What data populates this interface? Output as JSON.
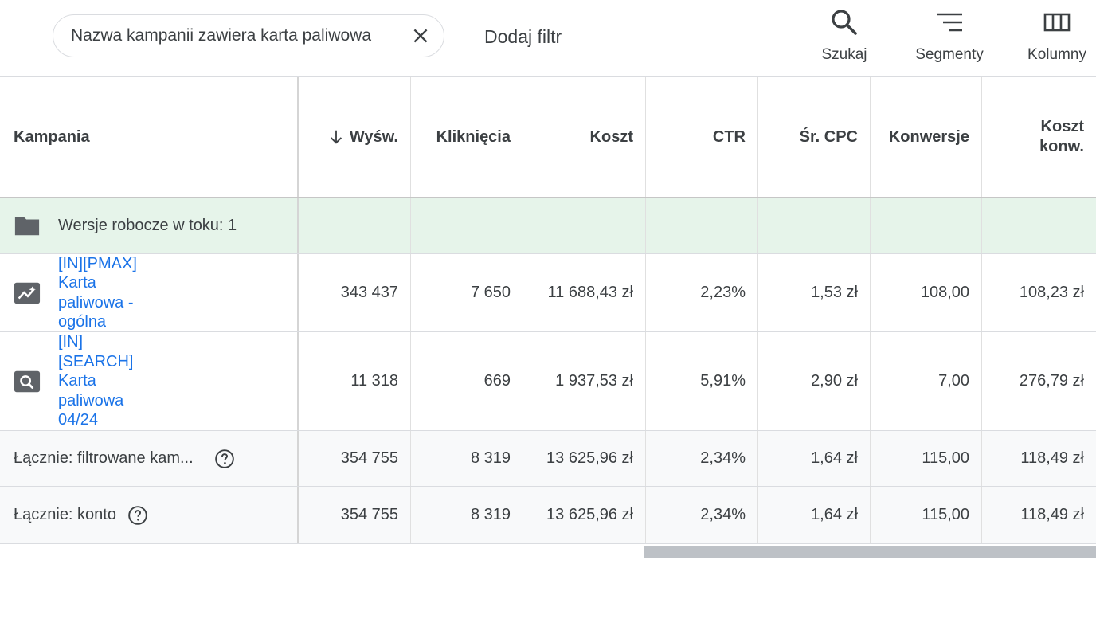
{
  "toolbar": {
    "filter_chip": "Nazwa kampanii zawiera karta paliwowa",
    "add_filter": "Dodaj filtr",
    "search_label": "Szukaj",
    "segments_label": "Segmenty",
    "columns_label": "Kolumny"
  },
  "table": {
    "headers": {
      "campaign": "Kampania",
      "impressions": "Wyśw.",
      "clicks": "Kliknięcia",
      "cost": "Koszt",
      "ctr": "CTR",
      "avg_cpc": "Śr. CPC",
      "conversions": "Konwersje",
      "cost_conv_line1": "Koszt",
      "cost_conv_line2": "konw."
    },
    "drafts_label": "Wersje robocze w toku: 1",
    "campaigns": [
      {
        "icon": "performance-max-icon",
        "name_lines": [
          "[IN][PMAX]",
          "Karta",
          "paliwowa -",
          "ogólna"
        ],
        "impressions": "343 437",
        "clicks": "7 650",
        "cost": "11 688,43 zł",
        "ctr": "2,23%",
        "avg_cpc": "1,53 zł",
        "conversions": "108,00",
        "cost_conv": "108,23 zł"
      },
      {
        "icon": "search-campaign-icon",
        "name_lines": [
          "[IN]",
          "[SEARCH]",
          "Karta",
          "paliwowa",
          "04/24"
        ],
        "impressions": "11 318",
        "clicks": "669",
        "cost": "1 937,53 zł",
        "ctr": "5,91%",
        "avg_cpc": "2,90 zł",
        "conversions": "7,00",
        "cost_conv": "276,79 zł"
      }
    ],
    "totals": [
      {
        "label": "Łącznie: filtrowane kam...",
        "impressions": "354 755",
        "clicks": "8 319",
        "cost": "13 625,96 zł",
        "ctr": "2,34%",
        "avg_cpc": "1,64 zł",
        "conversions": "115,00",
        "cost_conv": "118,49 zł"
      },
      {
        "label": "Łącznie: konto",
        "impressions": "354 755",
        "clicks": "8 319",
        "cost": "13 625,96 zł",
        "ctr": "2,34%",
        "avg_cpc": "1,64 zł",
        "conversions": "115,00",
        "cost_conv": "118,49 zł"
      }
    ]
  },
  "colors": {
    "link": "#1a73e8",
    "draft_row_bg": "#e6f4ea",
    "icon_gray": "#5f6368",
    "scrollbar": "#bdc1c6"
  }
}
